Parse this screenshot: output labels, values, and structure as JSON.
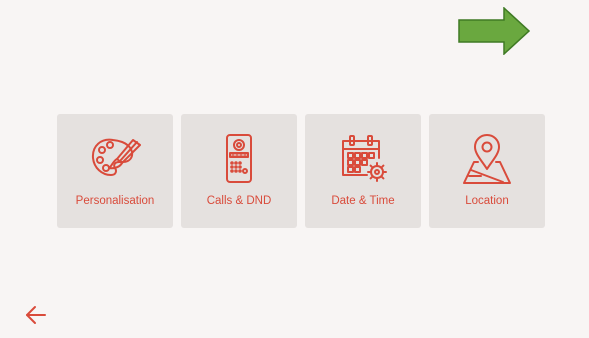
{
  "colors": {
    "background": "#f8f5f4",
    "tile_background": "#e5e1df",
    "accent": "#d94b3b",
    "annotation_arrow": "#5fa33b"
  },
  "tiles": [
    {
      "label": "Personalisation",
      "icon": "palette-icon"
    },
    {
      "label": "Calls & DND",
      "icon": "door-intercom-icon"
    },
    {
      "label": "Date & Time",
      "icon": "calendar-gear-icon"
    },
    {
      "label": "Location",
      "icon": "map-pin-icon"
    }
  ],
  "navigation": {
    "back_icon": "back-arrow-icon"
  },
  "annotation": {
    "icon": "green-arrow-right-icon"
  }
}
